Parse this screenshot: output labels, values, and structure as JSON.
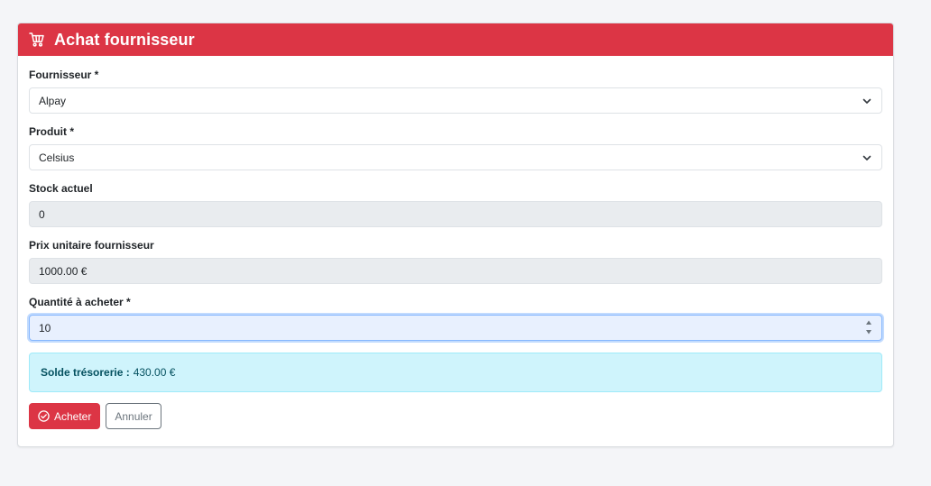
{
  "header": {
    "title": "Achat fournisseur",
    "icon": "cart-icon"
  },
  "form": {
    "supplier": {
      "label": "Fournisseur *",
      "value": "Alpay"
    },
    "product": {
      "label": "Produit *",
      "value": "Celsius"
    },
    "stock": {
      "label": "Stock actuel",
      "value": "0"
    },
    "unit_price": {
      "label": "Prix unitaire fournisseur",
      "value": "1000.00 €"
    },
    "quantity": {
      "label": "Quantité à acheter *",
      "value": "10"
    }
  },
  "alert": {
    "label": "Solde trésorerie :",
    "value": "430.00 €"
  },
  "actions": {
    "buy_label": "Acheter",
    "cancel_label": "Annuler"
  },
  "colors": {
    "primary": "#dc3545",
    "info_bg": "#cff4fc",
    "info_text": "#055160"
  }
}
